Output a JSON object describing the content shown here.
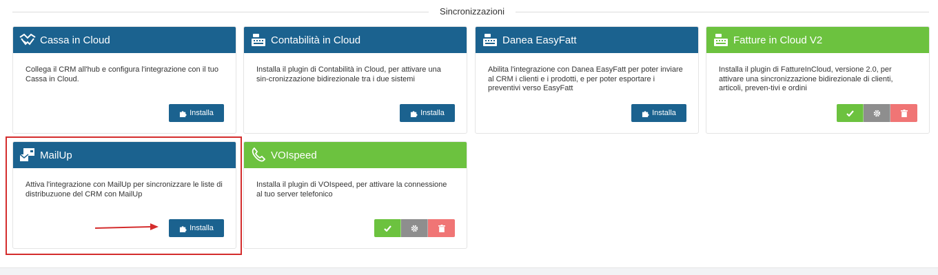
{
  "section": {
    "title": "Sincronizzazioni"
  },
  "colors": {
    "blue": "#1b628f",
    "green": "#6cc23f",
    "gray": "#8e8e8e",
    "red": "#f07575",
    "highlight": "#d42c2c"
  },
  "cards": [
    {
      "title": "Cassa in Cloud",
      "icon": "handshake-icon",
      "header_color": "blue",
      "desc": "Collega il CRM all'hub e configura l'integrazione con il tuo Cassa in Cloud.",
      "action": "Installa"
    },
    {
      "title": "Contabilità in Cloud",
      "icon": "cash-register-icon",
      "header_color": "blue",
      "desc": "Installa il plugin di Contabilità in Cloud, per attivare una sin-cronizzazione bidirezionale tra i due sistemi",
      "action": "Installa"
    },
    {
      "title": "Danea EasyFatt",
      "icon": "cash-register-icon",
      "header_color": "blue",
      "desc": "Abilita l'integrazione con Danea EasyFatt per poter inviare al CRM i clienti e i prodotti, e per poter esportare i preventivi verso EasyFatt",
      "action": "Installa"
    },
    {
      "title": "Fatture in Cloud V2",
      "icon": "cash-register-icon",
      "header_color": "green",
      "desc": "Installa il plugin di FattureInCloud, versione 2.0, per attivare una sincronizzazione bidirezionale di clienti, articoli, preven-tivi e ordini",
      "action": "installed"
    },
    {
      "title": "MailUp",
      "icon": "mail-box-icon",
      "header_color": "blue",
      "desc": "Attiva l'integrazione con MailUp per sincronizzare le liste di distribuzuone del CRM con MailUp",
      "action": "Installa"
    },
    {
      "title": "VOIspeed",
      "icon": "phone-icon",
      "header_color": "green",
      "desc": "Installa il plugin di VOIspeed, per attivare la connessione al tuo server telefonico",
      "action": "installed"
    }
  ]
}
